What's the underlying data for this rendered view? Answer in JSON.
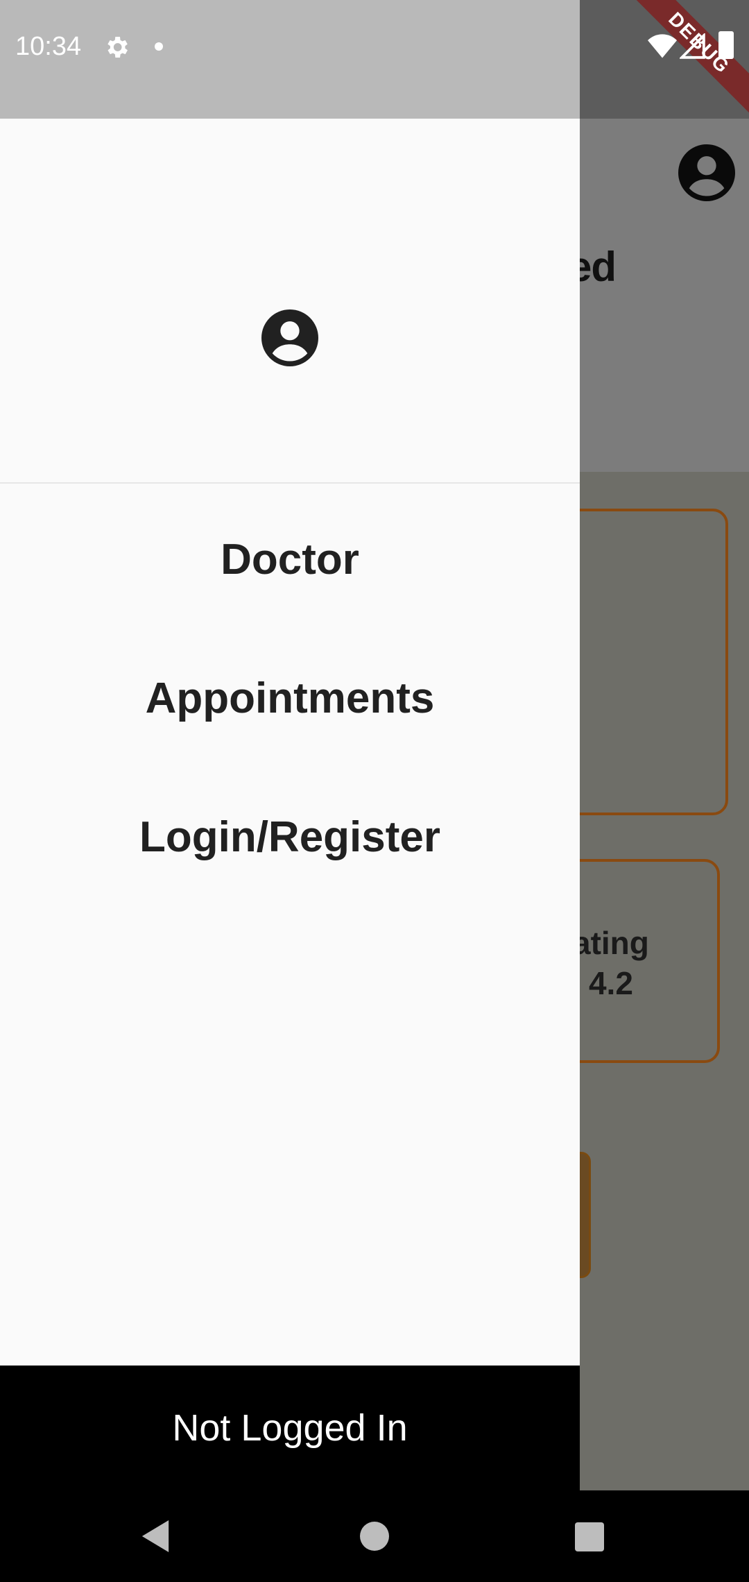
{
  "status_bar": {
    "time": "10:34",
    "debug_label": "DEBUG"
  },
  "background_app": {
    "title_fragment": "ed",
    "card2_line1": "ating",
    "card2_line2": "4.2"
  },
  "drawer": {
    "menu": [
      {
        "label": "Doctor"
      },
      {
        "label": "Appointments"
      },
      {
        "label": "Login/Register"
      }
    ],
    "footer_text": "Not Logged In"
  },
  "colors": {
    "drawer_bg": "#fafafa",
    "menu_text": "#212121",
    "card_border": "#8a4a10",
    "footer_bg": "#000000"
  }
}
